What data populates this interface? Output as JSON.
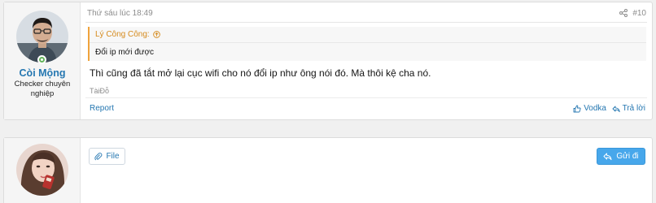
{
  "post": {
    "date": "Thứ sáu lúc 18:49",
    "number": "#10",
    "author": {
      "name": "Còi Mộng",
      "title": "Checker chuyên nghiệp"
    },
    "quote": {
      "author_label": "Lý Công Công:",
      "text": "Đổi ip mới được"
    },
    "message": "Thì cũng đã tắt mở lại cục wifi cho nó đổi ip như ông nói đó. Mà thôi kệ cha nó.",
    "tag": "TàiĐỗ",
    "actions": {
      "report": "Report",
      "react": "Vodka",
      "reply": "Trả lời"
    }
  },
  "reply_box": {
    "file_label": "File",
    "send_label": "Gửi đi"
  },
  "colors": {
    "link": "#2577b1",
    "quote_accent": "#f0a33c",
    "send_button": "#47a7eb",
    "online": "#63b35b"
  },
  "icons": [
    "user-avatar",
    "online-status-icon",
    "share-icon",
    "arrow-circle-up-icon",
    "thumbs-up-icon",
    "reply-icon",
    "paperclip-icon",
    "send-reply-icon"
  ]
}
